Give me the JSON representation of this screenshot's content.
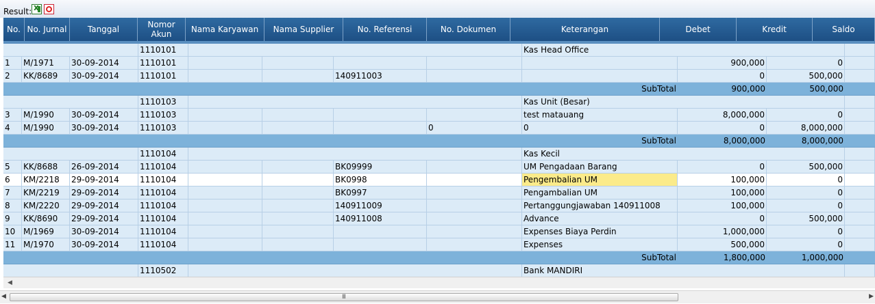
{
  "toolbar": {
    "result_label": "Result:",
    "export_excel_icon": "excel-icon",
    "export_pdf_icon": "pdf-icon"
  },
  "columns": [
    "No.",
    "No. Jurnal",
    "Tanggal",
    "Nomor Akun",
    "Nama Karyawan",
    "Nama Supplier",
    "No. Referensi",
    "No. Dokumen",
    "Keterangan",
    "Debet",
    "Kredit",
    "Saldo"
  ],
  "rows": [
    {
      "type": "group",
      "akun": "1110101",
      "keterangan": "Kas Head Office"
    },
    {
      "type": "data",
      "no": "1",
      "jurnal": "M/1971",
      "tanggal": "30-09-2014",
      "akun": "1110101",
      "karyawan": "",
      "supplier": "",
      "referensi": "",
      "dokumen": "",
      "keterangan": "",
      "debet": "900,000",
      "kredit": "0"
    },
    {
      "type": "data",
      "no": "2",
      "jurnal": "KK/8689",
      "tanggal": "30-09-2014",
      "akun": "1110101",
      "karyawan": "",
      "supplier": "",
      "referensi": "140911003",
      "dokumen": "",
      "keterangan": "",
      "debet": "0",
      "kredit": "500,000"
    },
    {
      "type": "subtotal",
      "label": "SubTotal",
      "debet": "900,000",
      "kredit": "500,000"
    },
    {
      "type": "group",
      "akun": "1110103",
      "keterangan": "Kas Unit (Besar)"
    },
    {
      "type": "data",
      "no": "3",
      "jurnal": "M/1990",
      "tanggal": "30-09-2014",
      "akun": "1110103",
      "karyawan": "",
      "supplier": "",
      "referensi": "",
      "dokumen": "",
      "keterangan": "test matauang",
      "debet": "8,000,000",
      "kredit": "0"
    },
    {
      "type": "data",
      "no": "4",
      "jurnal": "M/1990",
      "tanggal": "30-09-2014",
      "akun": "1110103",
      "karyawan": "",
      "supplier": "",
      "referensi": "",
      "dokumen": "0",
      "keterangan": "0",
      "debet": "0",
      "kredit": "8,000,000"
    },
    {
      "type": "subtotal",
      "label": "SubTotal",
      "debet": "8,000,000",
      "kredit": "8,000,000"
    },
    {
      "type": "group",
      "akun": "1110104",
      "keterangan": "Kas Kecil"
    },
    {
      "type": "data",
      "no": "5",
      "jurnal": "KK/8688",
      "tanggal": "26-09-2014",
      "akun": "1110104",
      "karyawan": "",
      "supplier": "",
      "referensi": "BK09999",
      "dokumen": "",
      "keterangan": "UM Pengadaan Barang",
      "debet": "0",
      "kredit": "500,000"
    },
    {
      "type": "data",
      "no": "6",
      "jurnal": "KM/2218",
      "tanggal": "29-09-2014",
      "akun": "1110104",
      "karyawan": "",
      "supplier": "",
      "referensi": "BK0998",
      "dokumen": "",
      "keterangan": "Pengembalian UM",
      "debet": "100,000",
      "kredit": "0",
      "selected": true
    },
    {
      "type": "data",
      "no": "7",
      "jurnal": "KM/2219",
      "tanggal": "29-09-2014",
      "akun": "1110104",
      "karyawan": "",
      "supplier": "",
      "referensi": "BK0997",
      "dokumen": "",
      "keterangan": "Pengambalian UM",
      "debet": "100,000",
      "kredit": "0"
    },
    {
      "type": "data",
      "no": "8",
      "jurnal": "KM/2220",
      "tanggal": "29-09-2014",
      "akun": "1110104",
      "karyawan": "",
      "supplier": "",
      "referensi": "140911009",
      "dokumen": "",
      "keterangan": "Pertanggungjawaban 140911008",
      "debet": "100,000",
      "kredit": "0"
    },
    {
      "type": "data",
      "no": "9",
      "jurnal": "KK/8690",
      "tanggal": "29-09-2014",
      "akun": "1110104",
      "karyawan": "",
      "supplier": "",
      "referensi": "140911008",
      "dokumen": "",
      "keterangan": "Advance",
      "debet": "0",
      "kredit": "500,000"
    },
    {
      "type": "data",
      "no": "10",
      "jurnal": "M/1969",
      "tanggal": "30-09-2014",
      "akun": "1110104",
      "karyawan": "",
      "supplier": "",
      "referensi": "",
      "dokumen": "",
      "keterangan": "Expenses Biaya Perdin",
      "debet": "1,000,000",
      "kredit": "0"
    },
    {
      "type": "data",
      "no": "11",
      "jurnal": "M/1970",
      "tanggal": "30-09-2014",
      "akun": "1110104",
      "karyawan": "",
      "supplier": "",
      "referensi": "",
      "dokumen": "",
      "keterangan": "Expenses",
      "debet": "500,000",
      "kredit": "0"
    },
    {
      "type": "subtotal",
      "label": "SubTotal",
      "debet": "1,800,000",
      "kredit": "1,000,000"
    },
    {
      "type": "group",
      "akun": "1110502",
      "keterangan": "Bank MANDIRI"
    }
  ],
  "scrollbar": {
    "grip": "III"
  }
}
